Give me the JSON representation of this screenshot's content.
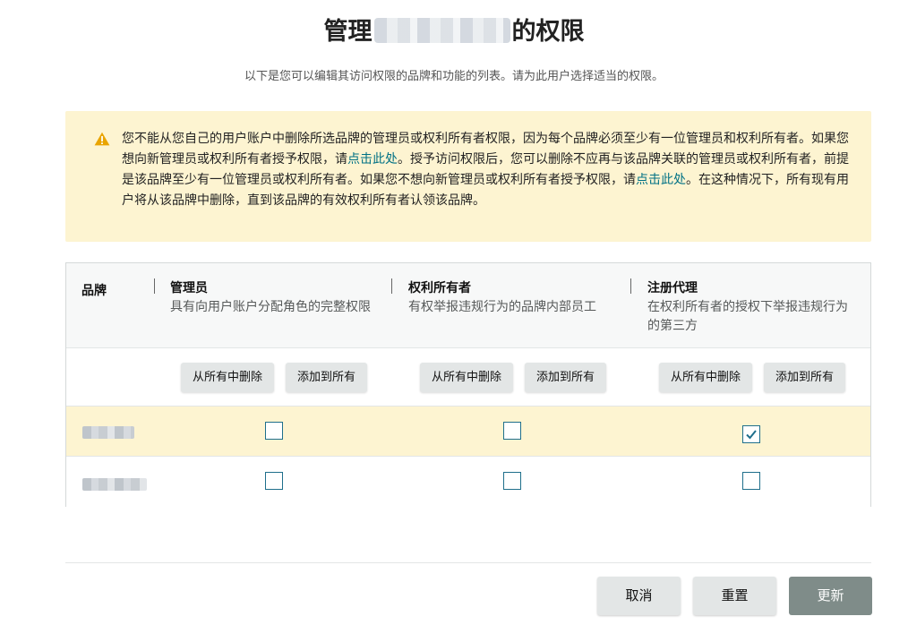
{
  "title": {
    "prefix": "管理",
    "suffix": "的权限"
  },
  "subtitle": "以下是您可以编辑其访问权限的品牌和功能的列表。请为此用户选择适当的权限。",
  "alert": {
    "icon": "warning-icon",
    "text_1": "您不能从您自己的用户账户中删除所选品牌的管理员或权利所有者权限，因为每个品牌必须至少有一位管理员和权利所有者。如果您想向新管理员或权利所有者授予权限，请",
    "link_1": "点击此处",
    "text_2": "。授予访问权限后，您可以删除不应再与该品牌关联的管理员或权利所有者，前提是该品牌至少有一位管理员或权利所有者。如果您不想向新管理员或权利所有者授予权限，请",
    "link_2": "点击此处",
    "text_3": "。在这种情况下，所有现有用户将从该品牌中删除，直到该品牌的有效权利所有者认领该品牌。"
  },
  "table": {
    "brand_header": "品牌",
    "columns": [
      {
        "name": "管理员",
        "description": "具有向用户账户分配角色的完整权限"
      },
      {
        "name": "权利所有者",
        "description": "有权举报违规行为的品牌内部员工"
      },
      {
        "name": "注册代理",
        "description": "在权利所有者的授权下举报违规行为的第三方"
      }
    ],
    "remove_all_label": "从所有中删除",
    "add_all_label": "添加到所有",
    "rows": [
      {
        "highlighted": true,
        "checked": [
          false,
          false,
          true
        ]
      },
      {
        "highlighted": false,
        "checked": [
          false,
          false,
          false
        ]
      }
    ]
  },
  "footer": {
    "cancel_label": "取消",
    "reset_label": "重置",
    "update_label": "更新"
  },
  "colors": {
    "alert_bg": "#fdf4d1",
    "link": "#007185",
    "checkbox_border": "#1f6f8b",
    "update_disabled": "#7f8c89"
  }
}
